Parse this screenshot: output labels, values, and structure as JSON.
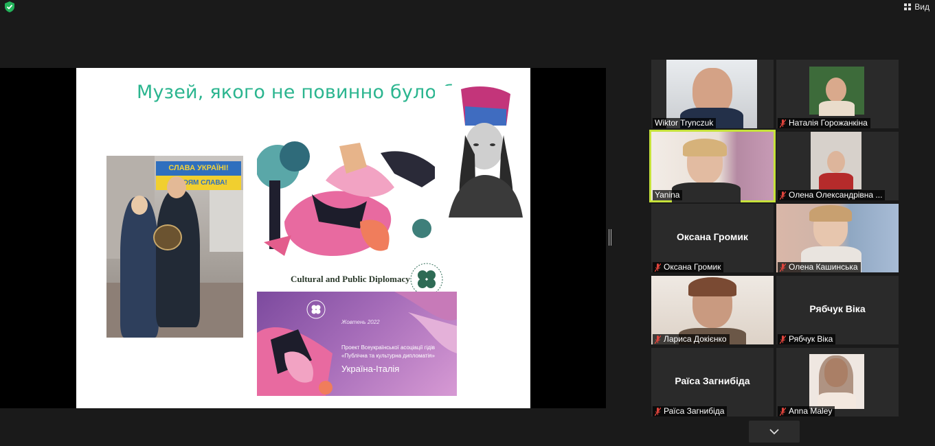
{
  "topbar": {
    "view_label": "Вид",
    "secure_icon": "shield-check-icon"
  },
  "slide": {
    "title": "Музей, якого не повинно було бути…",
    "banner_line1": "СЛАВА УКРАЇНІ!",
    "banner_line2": "ГЕРОЯМ СЛАВА!",
    "caption": "Cultural and Public Diplomacy",
    "card": {
      "month": "Жовтень 2022",
      "project_text": "Проект Всеукраїнської асоціації гідів «Публічна та культурна дипломатія»",
      "countries": "Україна-Італія"
    }
  },
  "participants": [
    {
      "name": "Wiktor Trynczuk",
      "muted": false,
      "video": true,
      "active": false
    },
    {
      "name": "Наталія Горожанкіна",
      "muted": true,
      "video": true,
      "active": false
    },
    {
      "name": "Yanina",
      "muted": false,
      "video": true,
      "active": true
    },
    {
      "name": "Олена Олександрівна ...",
      "muted": true,
      "video": true,
      "active": false
    },
    {
      "name": "Оксана Громик",
      "display_name": "Оксана Громик",
      "muted": true,
      "video": false,
      "active": false
    },
    {
      "name": "Олена Кашинська",
      "muted": true,
      "video": true,
      "active": false
    },
    {
      "name": "Лариса Докієнко",
      "muted": true,
      "video": true,
      "active": false
    },
    {
      "name": "Рябчук Віка",
      "display_name": "Рябчук Віка",
      "muted": true,
      "video": false,
      "active": false
    },
    {
      "name": "Раїса Загнибіда",
      "display_name": "Раїса Загнибіда",
      "muted": true,
      "video": false,
      "active": false
    },
    {
      "name": "Anna Maley",
      "muted": true,
      "video": true,
      "active": false
    }
  ],
  "colors": {
    "accent_active": "#c6e23a",
    "title_green": "#2bb58f",
    "muted_red": "#e0443c"
  }
}
